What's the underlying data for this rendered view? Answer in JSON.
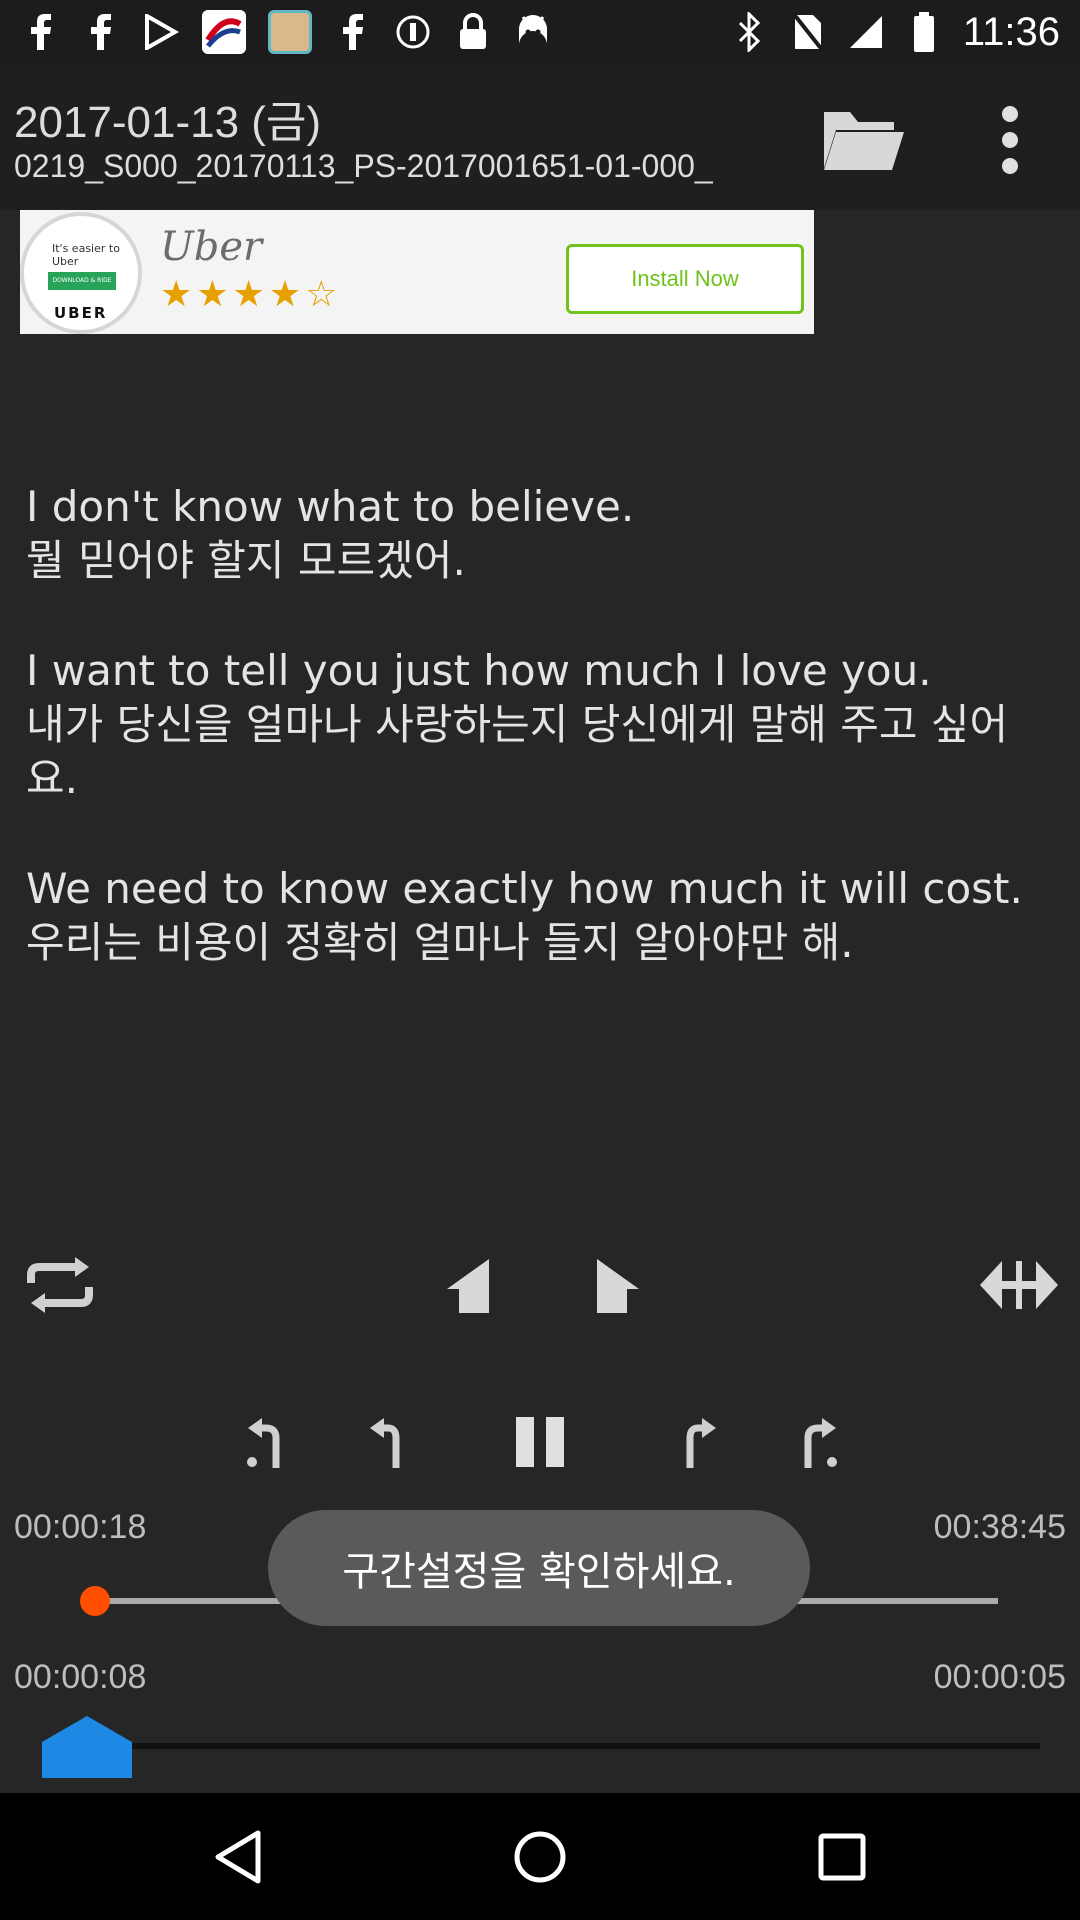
{
  "status_bar": {
    "time": "11:36",
    "left_icons": [
      "facebook-icon",
      "facebook-icon",
      "play-store-icon",
      "airline-app-icon",
      "photo-app-icon",
      "facebook-icon",
      "info-icon",
      "lock-icon",
      "android-icon"
    ],
    "right_icons": [
      "bluetooth-icon",
      "no-sim-icon",
      "signal-icon",
      "battery-icon"
    ]
  },
  "header": {
    "date": "2017-01-13 (금)",
    "filename": "0219_S000_20170113_PS-2017001651-01-000_"
  },
  "ad": {
    "logo_tagline": "It's easier to Uber",
    "logo_button_text": "DOWNLOAD & RIDE",
    "logo_text": "UBER",
    "brand": "Uber",
    "stars": "★★★★☆",
    "rating": 4.5,
    "install_label": "Install Now",
    "button_color": "#6fc31c"
  },
  "sentences": [
    {
      "en": "I don't know what to believe.",
      "ko": "뭘 믿어야 할지 모르겠어."
    },
    {
      "en": "I want to tell you just how much I love you.",
      "ko": "내가 당신을 얼마나 사랑하는지 당신에게 말해 주고 싶어요."
    },
    {
      "en": "We need to know exactly how much it will cost.",
      "ko": "우리는 비용이 정확히 얼마나 들지 알아야만 해."
    }
  ],
  "player": {
    "current_time": "00:00:18",
    "total_time": "00:38:45",
    "progress_fraction": 0.008,
    "section_start": "00:00:08",
    "section_end": "00:00:05",
    "toast": "구간설정을 확인하세요."
  },
  "colors": {
    "background": "#262626",
    "accent_thumb": "#ff4e00",
    "section_marker": "#1e88e5"
  }
}
